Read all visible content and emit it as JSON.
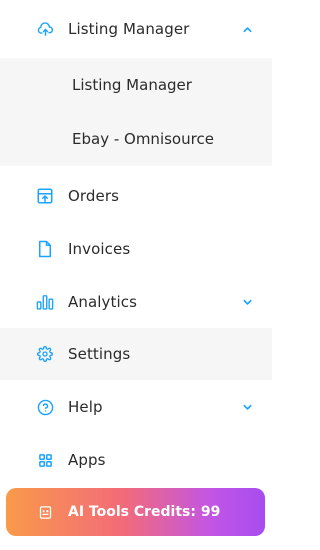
{
  "sidebar": {
    "accent_color": "#1aa3ff",
    "listing_manager": {
      "label": "Listing Manager",
      "icon": "cloud-upload-icon",
      "expanded": true,
      "children": [
        "Listing Manager",
        "Ebay - Omnisource"
      ]
    },
    "items": [
      {
        "label": "Orders",
        "icon": "box-arrow-up-icon"
      },
      {
        "label": "Invoices",
        "icon": "document-icon"
      },
      {
        "label": "Analytics",
        "icon": "bar-chart-icon"
      },
      {
        "label": "Settings",
        "icon": "gear-icon"
      },
      {
        "label": "Help",
        "icon": "question-circle-icon"
      },
      {
        "label": "Apps",
        "icon": "grid-icon"
      }
    ],
    "credits": {
      "label": "AI Tools Credits: 99",
      "icon": "robot-icon",
      "gradient": [
        "#f99a4a",
        "#f26b79",
        "#c155e6",
        "#a74cf0"
      ]
    }
  }
}
